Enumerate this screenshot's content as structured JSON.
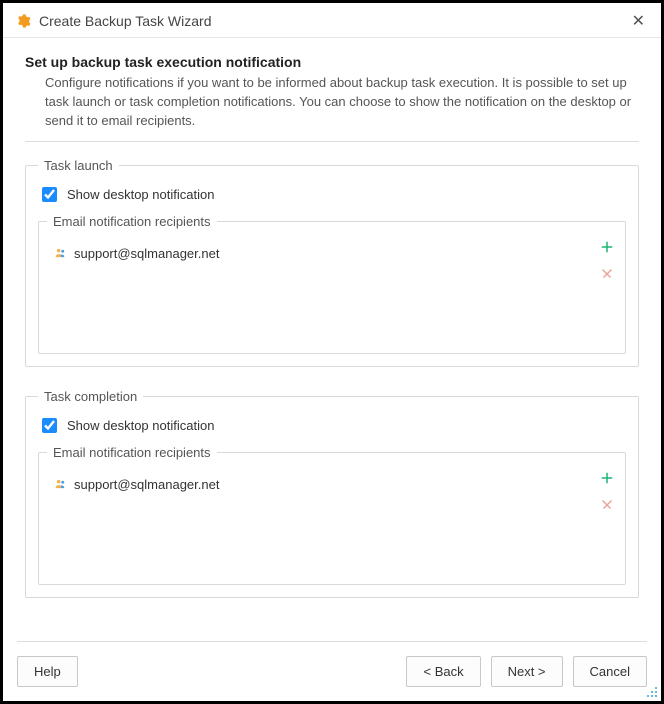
{
  "window": {
    "title": "Create Backup Task Wizard"
  },
  "page": {
    "heading": "Set up backup task execution notification",
    "description": "Configure notifications if you want to be informed about backup task execution. It is possible to set up task launch or task completion notifications. You can choose to show the notification on the desktop or send it to email recipients."
  },
  "groups": {
    "launch": {
      "legend": "Task launch",
      "show_desktop_label": "Show desktop notification",
      "show_desktop_checked": true,
      "recipients_legend": "Email notification recipients",
      "recipients": [
        "support@sqlmanager.net"
      ]
    },
    "completion": {
      "legend": "Task completion",
      "show_desktop_label": "Show desktop notification",
      "show_desktop_checked": true,
      "recipients_legend": "Email notification recipients",
      "recipients": [
        "support@sqlmanager.net"
      ]
    }
  },
  "buttons": {
    "help": "Help",
    "back": "< Back",
    "next": "Next >",
    "cancel": "Cancel"
  }
}
